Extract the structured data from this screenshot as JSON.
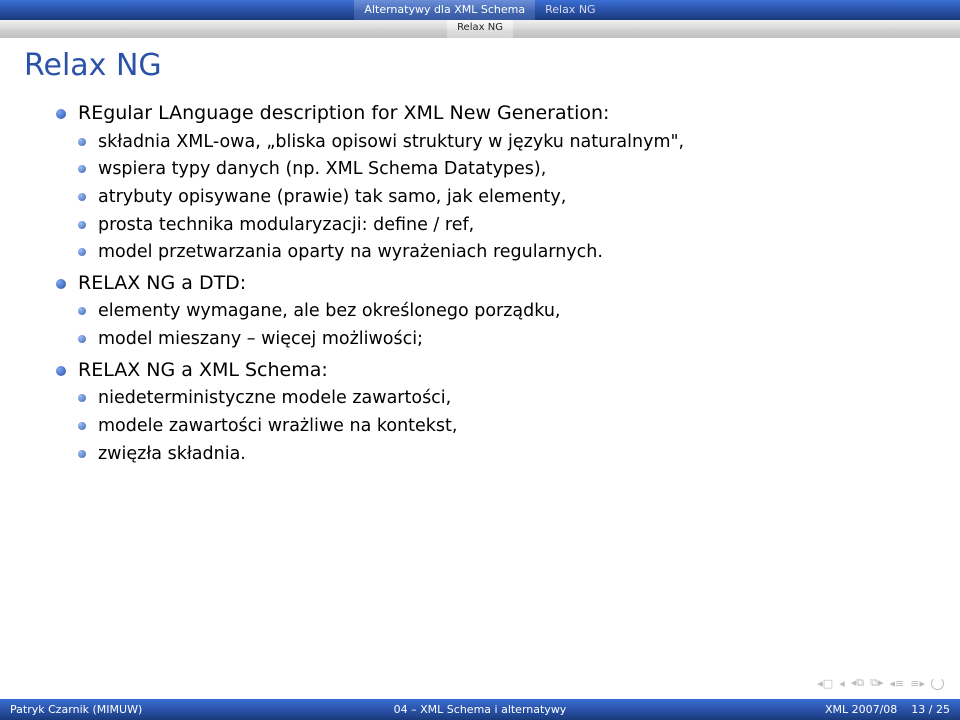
{
  "nav": {
    "tab_active": "Alternatywy dla XML Schema",
    "tab_secondary": "Relax NG",
    "subtab": "Relax NG"
  },
  "title": "Relax NG",
  "bullets": {
    "b1": "REgular LAnguage description for XML New Generation:",
    "b1_sub": {
      "a": "składnia XML-owa, „bliska opisowi struktury w języku naturalnym\",",
      "b": "wspiera typy danych (np. XML Schema Datatypes),",
      "c": "atrybuty opisywane (prawie) tak samo, jak elementy,",
      "d": "prosta technika modularyzacji: define / ref,",
      "e": "model przetwarzania oparty na wyrażeniach regularnych."
    },
    "b2": "RELAX NG a DTD:",
    "b2_sub": {
      "a": "elementy wymagane, ale bez określonego porządku,",
      "b": "model mieszany – więcej możliwości;"
    },
    "b3": "RELAX NG a XML Schema:",
    "b3_sub": {
      "a": "niedeterministyczne modele zawartości,",
      "b": "modele zawartości wrażliwe na kontekst,",
      "c": "zwięzła składnia."
    }
  },
  "nav_controls": {
    "first": "◂◂",
    "prev": "◂",
    "next": "▸",
    "last": "▸▸",
    "back": "◂",
    "fwd": "▸"
  },
  "footer": {
    "left": "Patryk Czarnik (MIMUW)",
    "center": "04 – XML Schema i alternatywy",
    "right_label": "XML 2007/08",
    "right_page": "13 / 25"
  }
}
